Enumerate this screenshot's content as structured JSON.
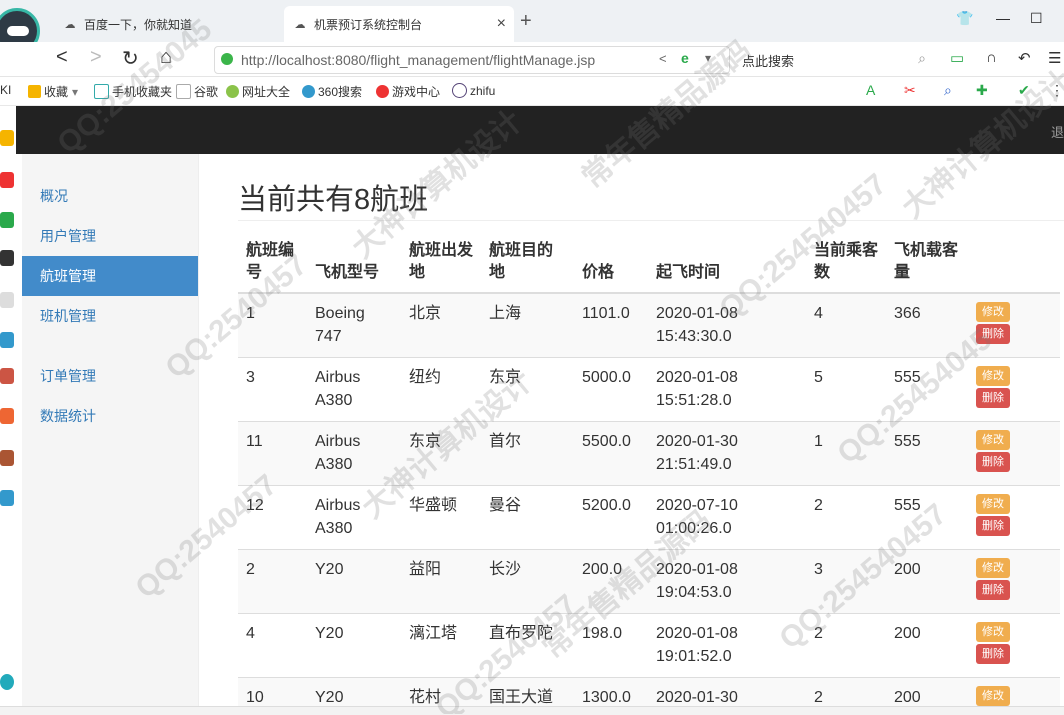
{
  "browser": {
    "tabs": [
      {
        "title": "百度一下，你就知道",
        "active": false
      },
      {
        "title": "机票预订系统控制台",
        "active": true
      }
    ],
    "new_tab_label": "+",
    "url": "http://localhost:8080/flight_management/flightManage.jsp",
    "search_placeholder": "点此搜索",
    "bookmarks": [
      "收藏",
      "手机收藏夹",
      "谷歌",
      "网址大全",
      "360搜索",
      "游戏中心",
      "zhifu"
    ],
    "left_stub": "KI"
  },
  "navbar": {
    "logout_label": "退"
  },
  "sidebar": {
    "items": [
      {
        "label": "概况",
        "active": false
      },
      {
        "label": "用户管理",
        "active": false
      },
      {
        "label": "航班管理",
        "active": true
      },
      {
        "label": "班机管理",
        "active": false
      },
      {
        "label": "订单管理",
        "active": false
      },
      {
        "label": "数据统计",
        "active": false
      }
    ]
  },
  "main": {
    "title": "当前共有8航班",
    "columns": [
      "航班编号",
      "飞机型号",
      "航班出发地",
      "航班目的地",
      "价格",
      "起飞时间",
      "当前乘客数",
      "飞机载客量"
    ],
    "edit_label": "修改",
    "delete_label": "删除",
    "rows": [
      {
        "id": "1",
        "model": "Boeing 747",
        "from": "北京",
        "to": "上海",
        "price": "1101.0",
        "time": "2020-01-08 15:43:30.0",
        "passengers": "4",
        "capacity": "366"
      },
      {
        "id": "3",
        "model": "Airbus A380",
        "from": "纽约",
        "to": "东京",
        "price": "5000.0",
        "time": "2020-01-08 15:51:28.0",
        "passengers": "5",
        "capacity": "555"
      },
      {
        "id": "11",
        "model": "Airbus A380",
        "from": "东京",
        "to": "首尔",
        "price": "5500.0",
        "time": "2020-01-30 21:51:49.0",
        "passengers": "1",
        "capacity": "555"
      },
      {
        "id": "12",
        "model": "Airbus A380",
        "from": "华盛顿",
        "to": "曼谷",
        "price": "5200.0",
        "time": "2020-07-10 01:00:26.0",
        "passengers": "2",
        "capacity": "555"
      },
      {
        "id": "2",
        "model": "Y20",
        "from": "益阳",
        "to": "长沙",
        "price": "200.0",
        "time": "2020-01-08 19:04:53.0",
        "passengers": "3",
        "capacity": "200"
      },
      {
        "id": "4",
        "model": "Y20",
        "from": "漓江塔",
        "to": "直布罗陀",
        "price": "198.0",
        "time": "2020-01-08 19:01:52.0",
        "passengers": "2",
        "capacity": "200"
      },
      {
        "id": "10",
        "model": "Y20",
        "from": "花村",
        "to": "国王大道",
        "price": "1300.0",
        "time": "2020-01-30",
        "passengers": "2",
        "capacity": "200"
      }
    ]
  },
  "watermark": {
    "lines": [
      "QQ:25454045",
      "QQ:2540457",
      "大神计算机设计",
      "常年售精品源码",
      "QQ:254540457",
      "QQ:25454045",
      "QQ:2540457",
      "大神计算机设计",
      "常年售精品源码",
      "QQ:2540457",
      "QQ:254540457",
      "大神计算机设计"
    ]
  },
  "colors": {
    "accent": "#428bca",
    "navbar": "#222222",
    "edit": "#f0ad4e",
    "delete": "#d9534f"
  }
}
